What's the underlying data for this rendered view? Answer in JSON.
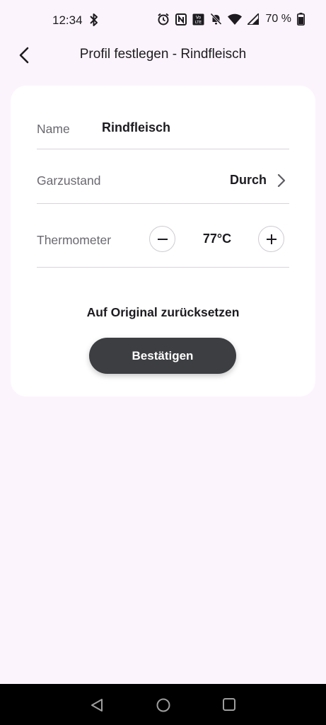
{
  "status_bar": {
    "time": "12:34",
    "battery": "70 %",
    "icons": [
      "bluetooth-icon",
      "alarm-icon",
      "nfc-icon",
      "volte-icon",
      "bell-muted-icon",
      "wifi-icon",
      "signal-icon",
      "battery-icon"
    ]
  },
  "header": {
    "title": "Profil festlegen - Rindfleisch",
    "back_icon": "chevron-left-icon"
  },
  "form": {
    "name_label": "Name",
    "name_value": "Rindfleisch",
    "garzustand_label": "Garzustand",
    "garzustand_value": "Durch",
    "thermometer_label": "Thermometer",
    "thermometer_value": "77°C",
    "reset_label": "Auf Original zurücksetzen",
    "confirm_label": "Bestätigen"
  },
  "colors": {
    "background": "#fcf4fc",
    "card": "#ffffff",
    "button": "#3d3e42",
    "label": "#6b6870"
  },
  "nav_bar": {
    "icons": [
      "nav-back-icon",
      "nav-home-icon",
      "nav-recents-icon"
    ]
  }
}
